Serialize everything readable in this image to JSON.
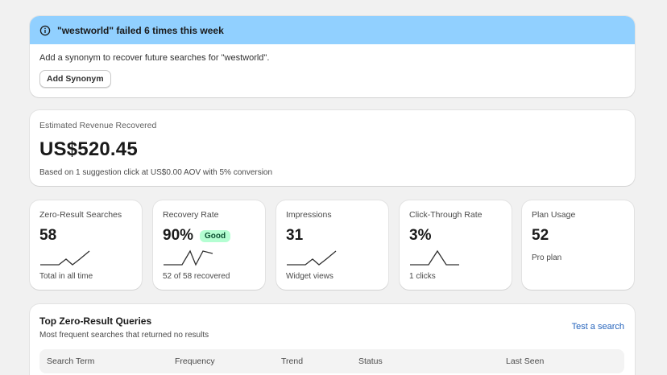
{
  "banner": {
    "title": "\"westworld\" failed 6 times this week",
    "text": "Add a synonym to recover future searches for \"westworld\".",
    "button_label": "Add Synonym",
    "color": "#91d0ff"
  },
  "revenue": {
    "label": "Estimated Revenue Recovered",
    "value": "US$520.45",
    "note": "Based on 1 suggestion click at US$0.00 AOV with 5% conversion"
  },
  "metrics": [
    {
      "label": "Zero-Result Searches",
      "value": "58",
      "sub": "Total in all time"
    },
    {
      "label": "Recovery Rate",
      "value": "90%",
      "badge": "Good",
      "sub": "52 of 58 recovered"
    },
    {
      "label": "Impressions",
      "value": "31",
      "sub": "Widget views"
    },
    {
      "label": "Click-Through Rate",
      "value": "3%",
      "sub": "1 clicks"
    },
    {
      "label": "Plan Usage",
      "value": "52",
      "sub": "Pro plan"
    }
  ],
  "queries": {
    "title": "Top Zero-Result Queries",
    "subtitle": "Most frequent searches that returned no results",
    "link": "Test a search",
    "columns": [
      "Search Term",
      "Frequency",
      "Trend",
      "Status",
      "Last Seen"
    ]
  },
  "colors": {
    "accent_link": "#2463bc",
    "badge_bg": "#b4fed2",
    "badge_text": "#0c5132"
  }
}
